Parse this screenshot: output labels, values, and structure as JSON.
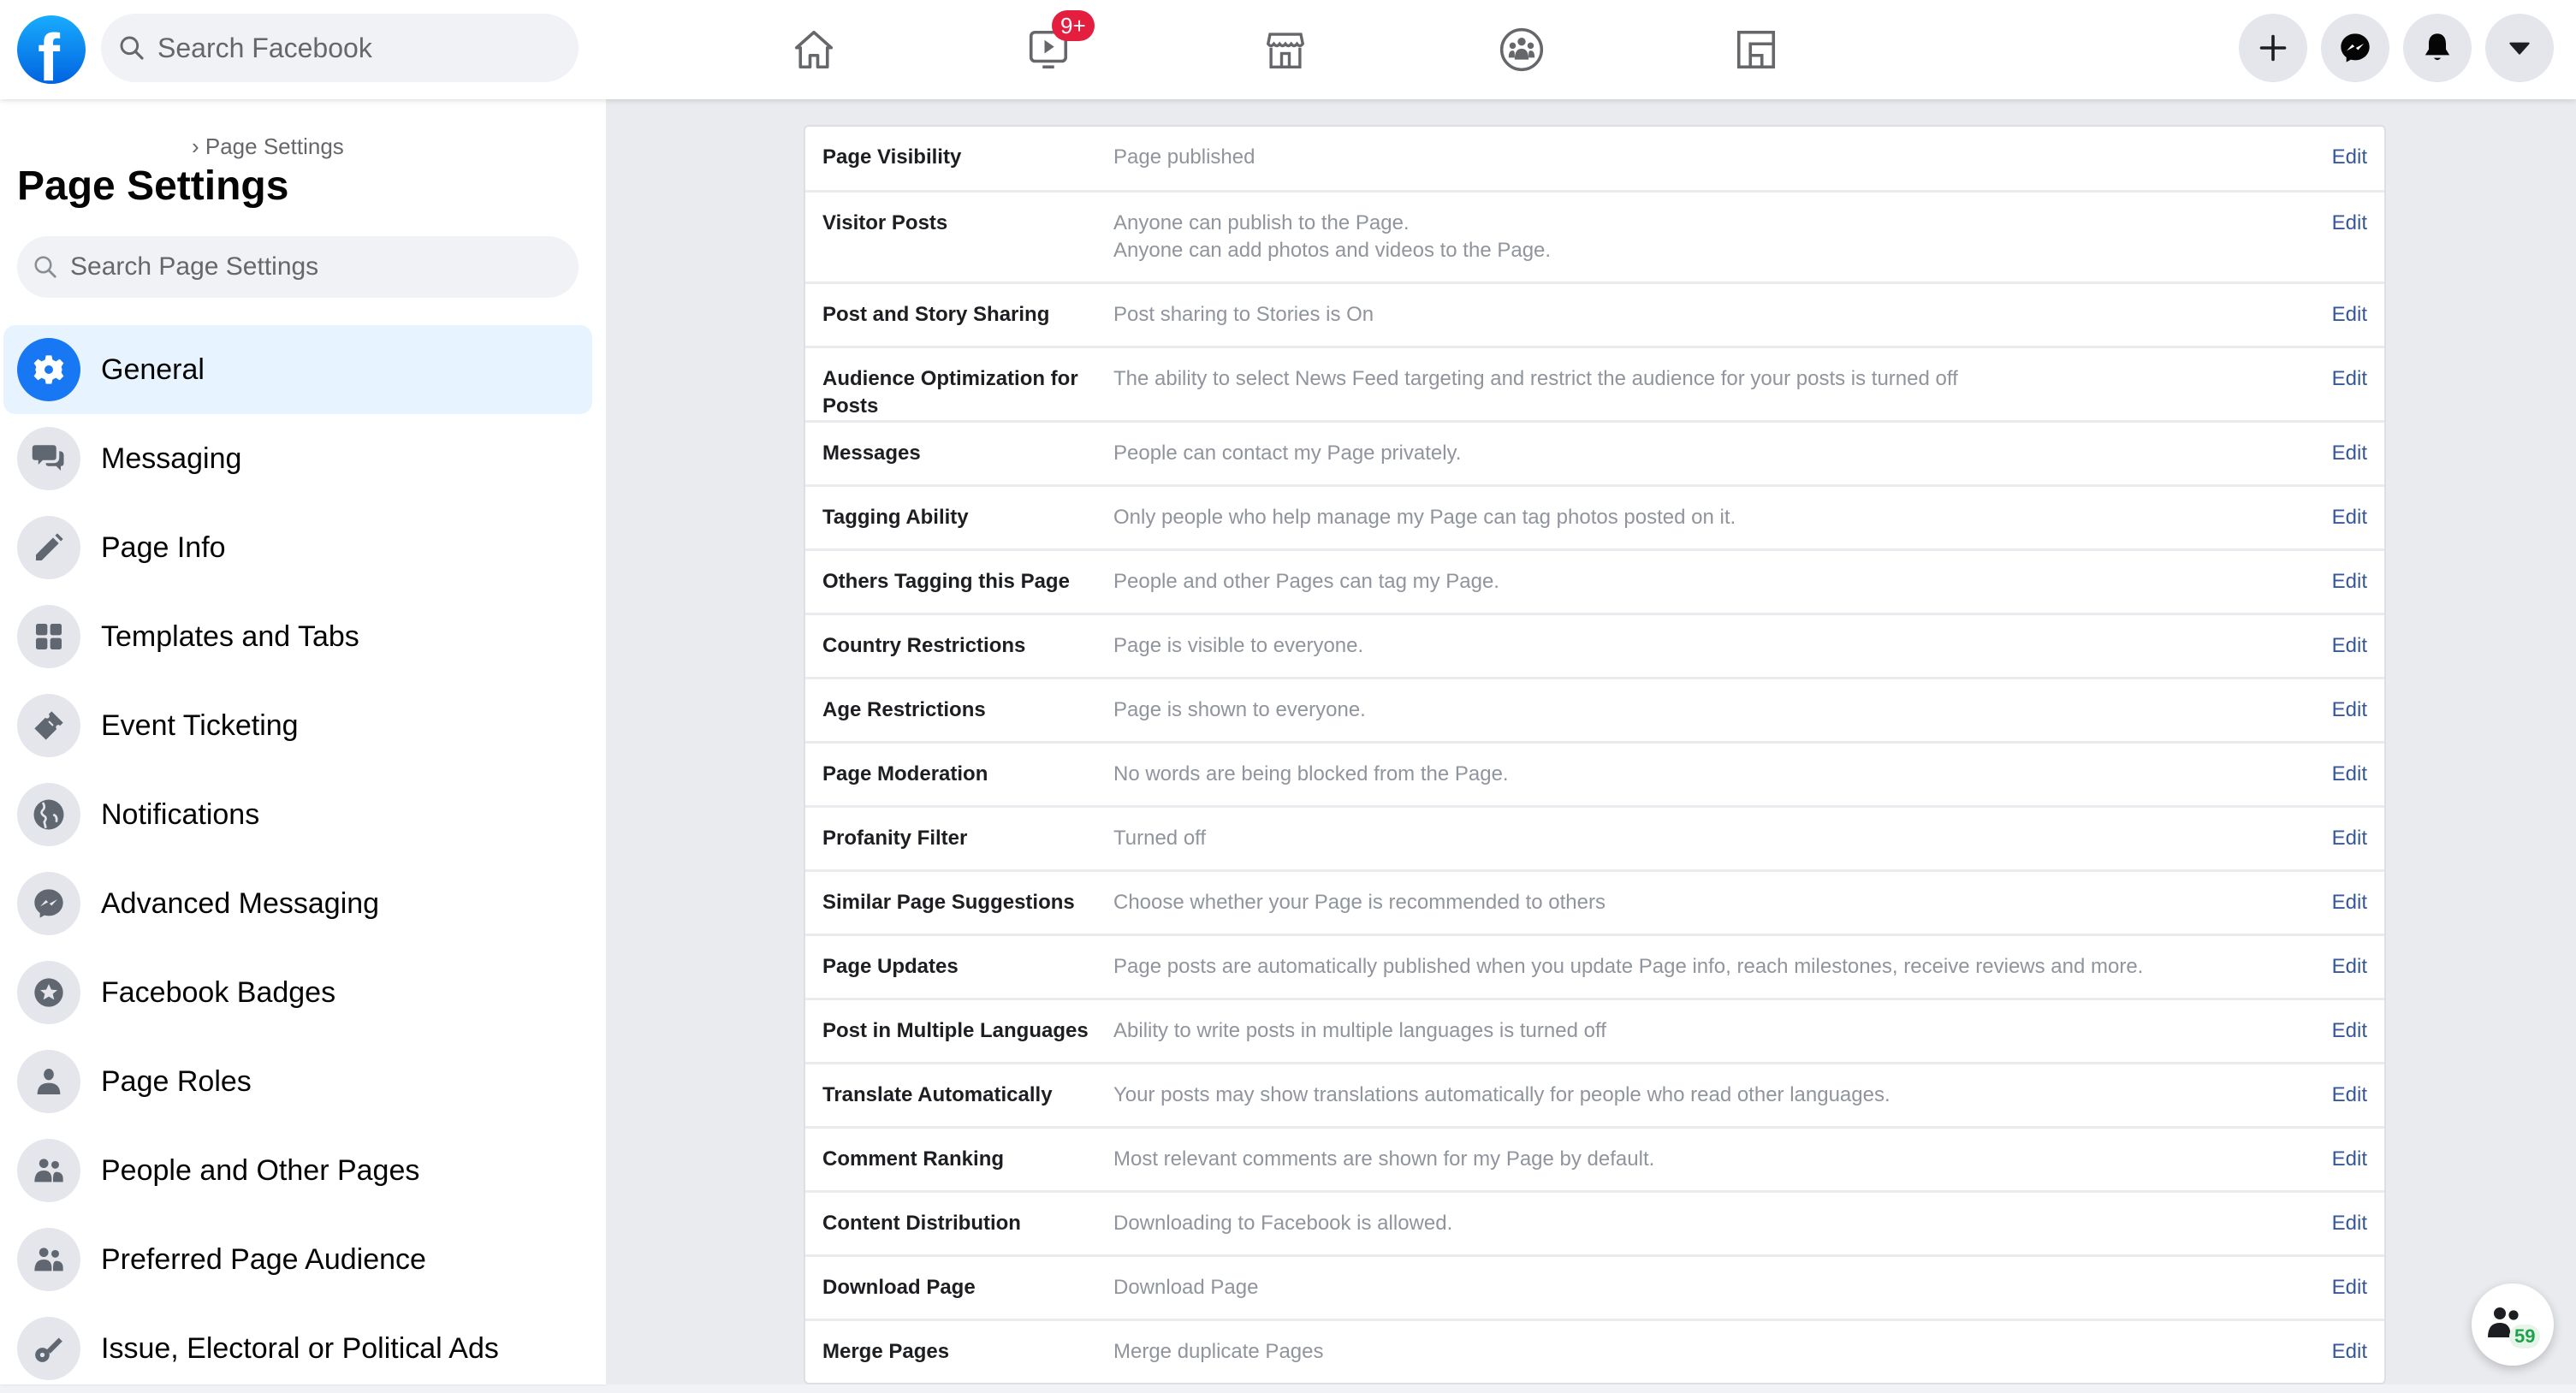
{
  "topbar": {
    "logo": "facebook-logo",
    "search_placeholder": "Search Facebook",
    "nav": [
      {
        "name": "home",
        "icon": "home-icon"
      },
      {
        "name": "watch",
        "icon": "video-icon",
        "badge": "9+"
      },
      {
        "name": "marketplace",
        "icon": "marketplace-icon"
      },
      {
        "name": "groups",
        "icon": "groups-icon"
      },
      {
        "name": "gaming",
        "icon": "gaming-icon"
      }
    ],
    "actions": [
      {
        "name": "create",
        "icon": "plus-icon"
      },
      {
        "name": "messenger",
        "icon": "messenger-icon"
      },
      {
        "name": "notifications",
        "icon": "bell-icon"
      },
      {
        "name": "account",
        "icon": "caret-down-icon"
      }
    ],
    "f_glyph": "f"
  },
  "sidebar": {
    "breadcrumb": "› Page Settings",
    "title": "Page Settings",
    "search_placeholder": "Search Page Settings",
    "items": [
      {
        "label": "General",
        "icon": "gear-icon",
        "active": true
      },
      {
        "label": "Messaging",
        "icon": "chat-bubbles-icon"
      },
      {
        "label": "Page Info",
        "icon": "pencil-icon"
      },
      {
        "label": "Templates and Tabs",
        "icon": "grid-icon"
      },
      {
        "label": "Event Ticketing",
        "icon": "ticket-icon"
      },
      {
        "label": "Notifications",
        "icon": "globe-icon"
      },
      {
        "label": "Advanced Messaging",
        "icon": "messenger-icon"
      },
      {
        "label": "Facebook Badges",
        "icon": "star-badge-icon"
      },
      {
        "label": "Page Roles",
        "icon": "person-icon"
      },
      {
        "label": "People and Other Pages",
        "icon": "people-icon"
      },
      {
        "label": "Preferred Page Audience",
        "icon": "people-icon"
      },
      {
        "label": "Issue, Electoral or Political Ads",
        "icon": "key-icon"
      }
    ]
  },
  "settings": {
    "edit_label": "Edit",
    "rows": [
      {
        "label": "Page Visibility",
        "value": [
          "Page published"
        ]
      },
      {
        "label": "Visitor Posts",
        "value": [
          "Anyone can publish to the Page.",
          "Anyone can add photos and videos to the Page."
        ]
      },
      {
        "label": "Post and Story Sharing",
        "value": [
          "Post sharing to Stories is On"
        ]
      },
      {
        "label": "Audience Optimization for Posts",
        "value": [
          "The ability to select News Feed targeting and restrict the audience for your posts is turned off"
        ]
      },
      {
        "label": "Messages",
        "value": [
          "People can contact my Page privately."
        ]
      },
      {
        "label": "Tagging Ability",
        "value": [
          "Only people who help manage my Page can tag photos posted on it."
        ]
      },
      {
        "label": "Others Tagging this Page",
        "value": [
          "People and other Pages can tag my Page."
        ]
      },
      {
        "label": "Country Restrictions",
        "value": [
          "Page is visible to everyone."
        ]
      },
      {
        "label": "Age Restrictions",
        "value": [
          "Page is shown to everyone."
        ]
      },
      {
        "label": "Page Moderation",
        "value": [
          "No words are being blocked from the Page."
        ]
      },
      {
        "label": "Profanity Filter",
        "value": [
          "Turned off"
        ]
      },
      {
        "label": "Similar Page Suggestions",
        "value": [
          "Choose whether your Page is recommended to others"
        ]
      },
      {
        "label": "Page Updates",
        "value": [
          "Page posts are automatically published when you update Page info, reach milestones, receive reviews and more."
        ]
      },
      {
        "label": "Post in Multiple Languages",
        "value": [
          "Ability to write posts in multiple languages is turned off"
        ]
      },
      {
        "label": "Translate Automatically",
        "value": [
          "Your posts may show translations automatically for people who read other languages."
        ]
      },
      {
        "label": "Comment Ranking",
        "value": [
          "Most relevant comments are shown for my Page by default."
        ]
      },
      {
        "label": "Content Distribution",
        "value": [
          "Downloading to Facebook is allowed."
        ]
      },
      {
        "label": "Download Page",
        "value": [
          "Download Page"
        ]
      },
      {
        "label": "Merge Pages",
        "value": [
          "Merge duplicate Pages"
        ]
      }
    ]
  },
  "floating": {
    "icon": "contacts-icon",
    "count": "59"
  },
  "colors": {
    "brand": "#1877f2",
    "link": "#365899",
    "badge": "#e41e3f",
    "active_bg": "#e7f3ff",
    "count_green": "#1fa34a"
  }
}
